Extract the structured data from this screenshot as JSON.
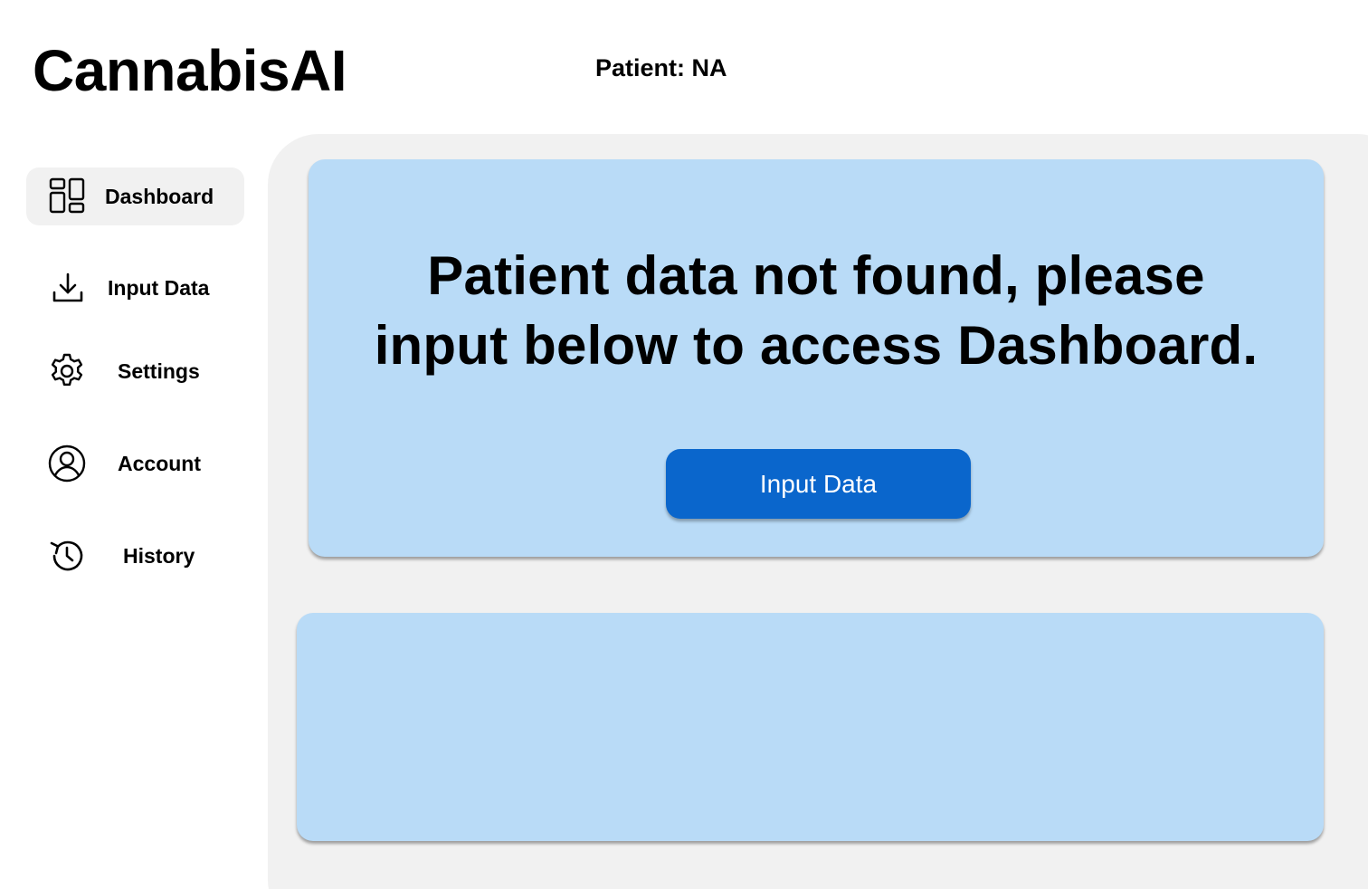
{
  "app": {
    "title": "CannabisAI"
  },
  "header": {
    "patient_label": "Patient: NA"
  },
  "sidebar": {
    "items": [
      {
        "label": "Dashboard",
        "icon": "dashboard-icon",
        "active": true
      },
      {
        "label": "Input Data",
        "icon": "download-icon",
        "active": false
      },
      {
        "label": "Settings",
        "icon": "gear-icon",
        "active": false
      },
      {
        "label": "Account",
        "icon": "user-circle-icon",
        "active": false
      },
      {
        "label": "History",
        "icon": "history-icon",
        "active": false
      }
    ]
  },
  "main": {
    "notice_line1": "Patient data not found, please",
    "notice_line2": "input below to access Dashboard.",
    "input_button_label": "Input Data"
  },
  "colors": {
    "card_background": "#b9dbf7",
    "panel_background": "#f1f1f1",
    "button_primary": "#0a66cc",
    "active_nav_background": "#f1f1f1"
  }
}
